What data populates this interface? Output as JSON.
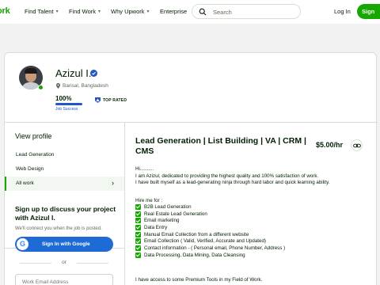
{
  "header": {
    "logo": "ork",
    "nav": [
      "Find Talent",
      "Find Work",
      "Why Upwork",
      "Enterprise"
    ],
    "search_placeholder": "Search",
    "login": "Log In",
    "signup": "Sign"
  },
  "profile": {
    "name": "Azizul I.",
    "location": "Barisal, Bangladesh",
    "job_success_value": "100%",
    "job_success_label": "Job Success",
    "job_success_pct": 100,
    "badge": "TOP RATED"
  },
  "sidebar": {
    "view_profile": "View profile",
    "items": [
      {
        "label": "Lead Generation"
      },
      {
        "label": "Web Design"
      },
      {
        "label": "All work"
      }
    ],
    "signup_title": "Sign up to discuss your project with Azizul I.",
    "signup_sub": "We'll connect you when the job is posted.",
    "google_button": "Sign In with Google",
    "google_letter": "G",
    "or": "or",
    "email_placeholder": "Work Email Address"
  },
  "main": {
    "title": "Lead Generation | List Building | VA | CRM | CMS",
    "rate": "$5.00/hr",
    "desc_lines": [
      "Hi..........",
      "I am Azizul, dedicated to providing the highest quality and 100% satisfaction of work.",
      "I have built myself as a lead-generating ninja through hard labor and quick learning ability."
    ],
    "hire_me": "Hire me for :",
    "services": [
      "B2B Lead Generation",
      "Real Estate Lead Generation",
      "Email marketing",
      "Data Entry",
      "Manual Email Collection from a different website",
      "Email Collection ( Valid, Verified, Accurate and Updated)",
      "Contact information - ( Personal email, Phone Number, Address )",
      "Data Processing, Data Mining, Data Cleansing"
    ],
    "tools": "I have access to some Premium Tools in my Field of Work."
  }
}
